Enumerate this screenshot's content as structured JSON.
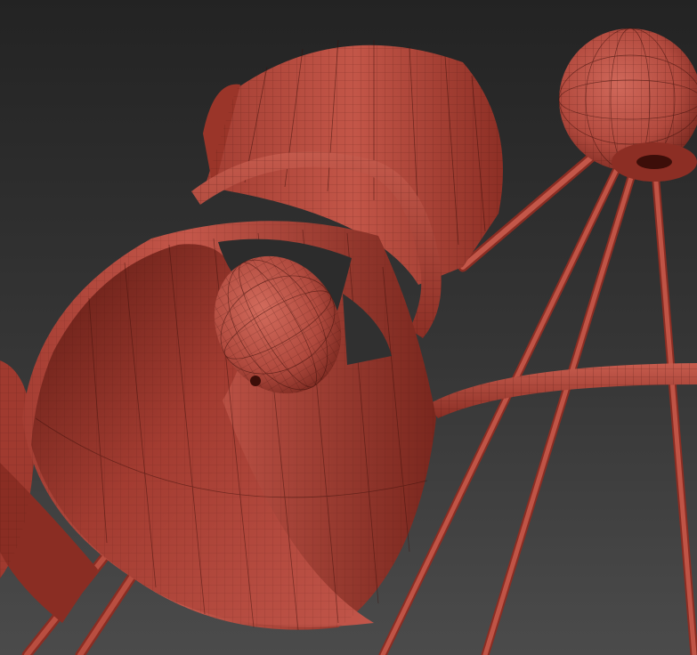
{
  "scene": {
    "description_visible_text": "",
    "colors": {
      "background_top": "#252525",
      "background_bottom": "#4a4a4a",
      "clay": "#b54a3e",
      "clay_light": "#c95a4c",
      "clay_dark": "#6e2018",
      "clay_shadow": "#4a120d",
      "wire": "#3a0f0a"
    },
    "objects": [
      "lamp-shade-front",
      "lamp-shade-back",
      "light-bulb",
      "torus-ring",
      "sphere-hub",
      "rod-arm",
      "shade-left-partial"
    ]
  }
}
